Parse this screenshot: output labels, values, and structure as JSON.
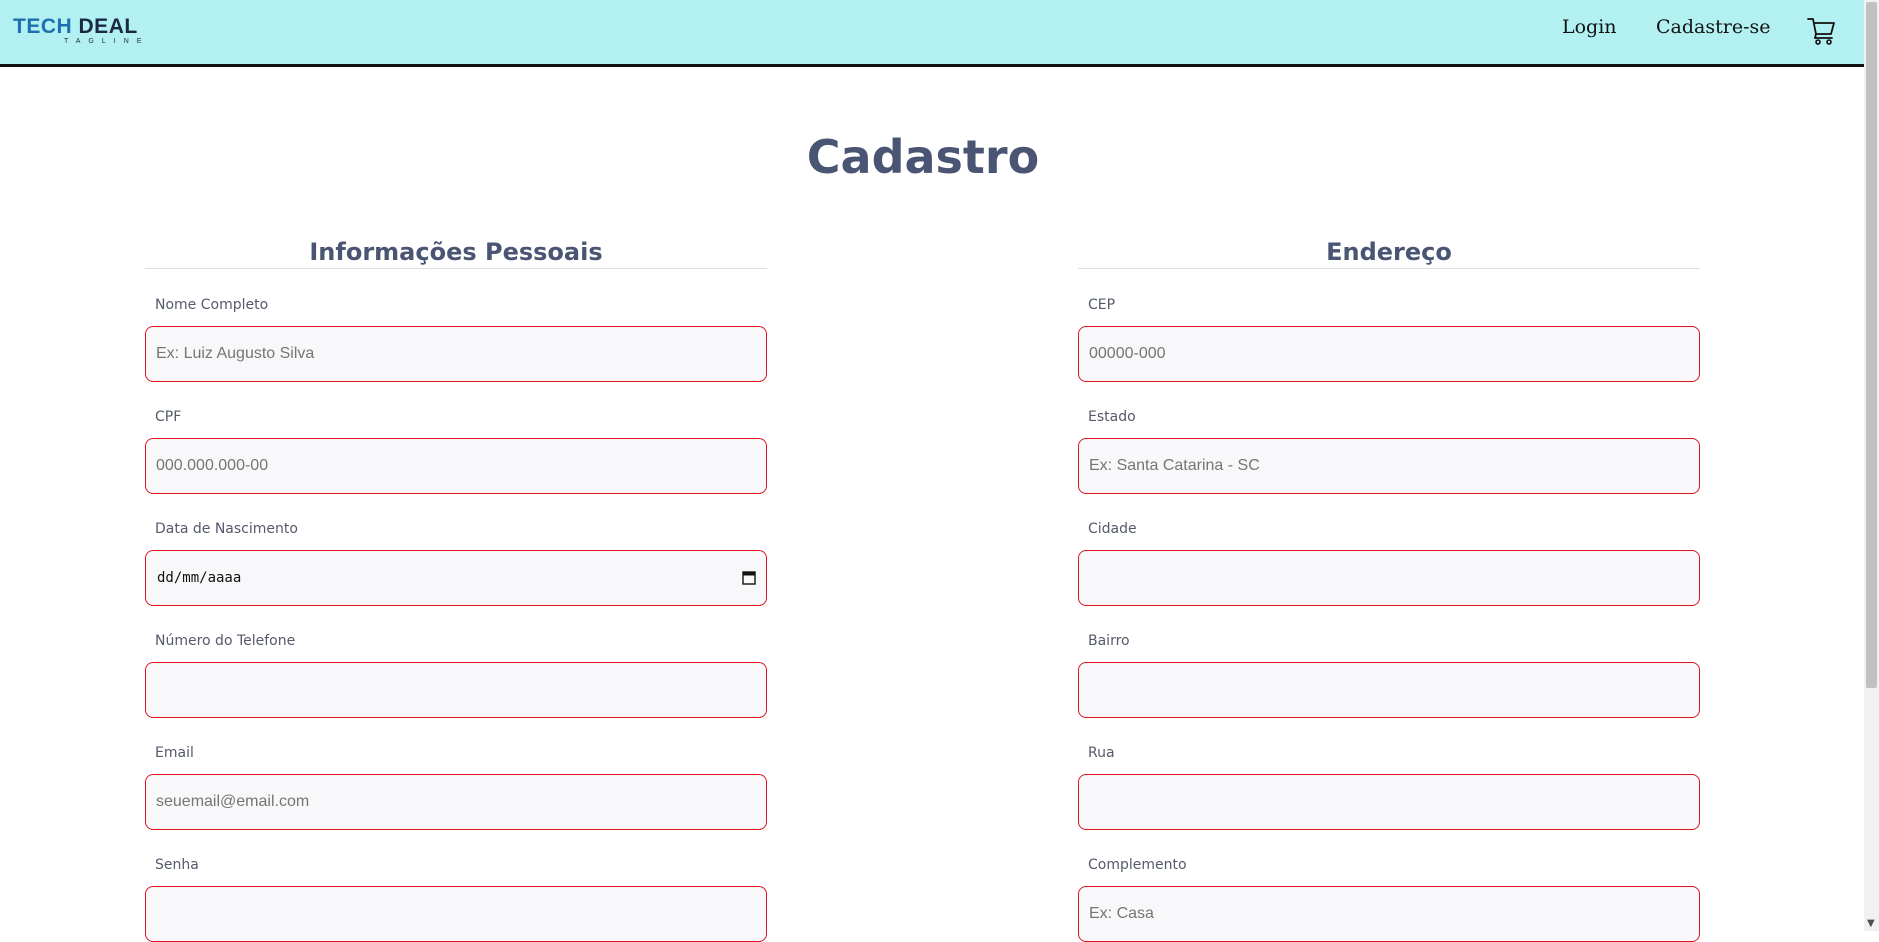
{
  "header": {
    "logo_tech": "TECH",
    "logo_deal": "DEAL",
    "logo_tagline": "TAGLINE",
    "nav": {
      "login": "Login",
      "signup": "Cadastre-se"
    },
    "cart_icon": "shopping-cart-icon"
  },
  "page": {
    "title": "Cadastro"
  },
  "personal": {
    "title": "Informações Pessoais",
    "fields": [
      {
        "label": "Nome Completo",
        "placeholder": "Ex: Luiz Augusto Silva"
      },
      {
        "label": "CPF",
        "placeholder": "000.000.000-00"
      },
      {
        "label": "Data de Nascimento",
        "value": "dd/mm/aaaa"
      },
      {
        "label": "Número do Telefone",
        "placeholder": ""
      },
      {
        "label": "Email",
        "placeholder": "seuemail@email.com"
      },
      {
        "label": "Senha",
        "placeholder": ""
      }
    ]
  },
  "address": {
    "title": "Endereço",
    "fields": [
      {
        "label": "CEP",
        "placeholder": "00000-000"
      },
      {
        "label": "Estado",
        "placeholder": "Ex: Santa Catarina - SC"
      },
      {
        "label": "Cidade",
        "placeholder": ""
      },
      {
        "label": "Bairro",
        "placeholder": ""
      },
      {
        "label": "Rua",
        "placeholder": ""
      },
      {
        "label": "Complemento",
        "placeholder": "Ex: Casa"
      }
    ]
  },
  "colors": {
    "header_bg": "#b3f0f2",
    "title": "#4a5573",
    "input_border": "#e0141e",
    "input_bg": "#f8f8fa"
  }
}
